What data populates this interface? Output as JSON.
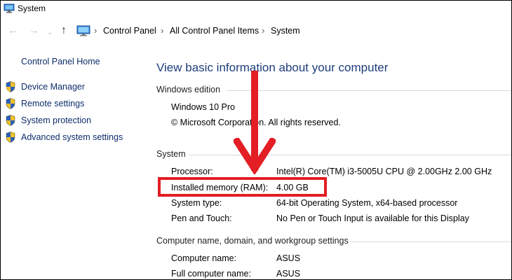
{
  "window": {
    "title": "System"
  },
  "nav": {
    "breadcrumbs": [
      "Control Panel",
      "All Control Panel Items",
      "System"
    ]
  },
  "sidebar": {
    "home": "Control Panel Home",
    "links": [
      "Device Manager",
      "Remote settings",
      "System protection",
      "Advanced system settings"
    ]
  },
  "main": {
    "title": "View basic information about your computer",
    "edition": {
      "header": "Windows edition",
      "name": "Windows 10 Pro",
      "copyright": "© Microsoft Corporation. All rights reserved."
    },
    "system": {
      "header": "System",
      "rows": [
        {
          "label": "Processor:",
          "value": "Intel(R) Core(TM) i3-5005U CPU @ 2.00GHz   2.00 GHz"
        },
        {
          "label": "Installed memory (RAM):",
          "value": "4.00 GB"
        },
        {
          "label": "System type:",
          "value": "64-bit Operating System, x64-based processor"
        },
        {
          "label": "Pen and Touch:",
          "value": "No Pen or Touch Input is available for this Display"
        }
      ]
    },
    "computer": {
      "header": "Computer name, domain, and workgroup settings",
      "rows": [
        {
          "label": "Computer name:",
          "value": "ASUS"
        },
        {
          "label": "Full computer name:",
          "value": "ASUS"
        }
      ]
    }
  },
  "colors": {
    "annotation": "#e31e24",
    "link": "#0d2d6b",
    "title": "#1e3d7b"
  },
  "icons": [
    "system-icon",
    "back-arrow-icon",
    "forward-arrow-icon",
    "up-arrow-icon",
    "control-panel-icon",
    "uac-shield-icon"
  ]
}
